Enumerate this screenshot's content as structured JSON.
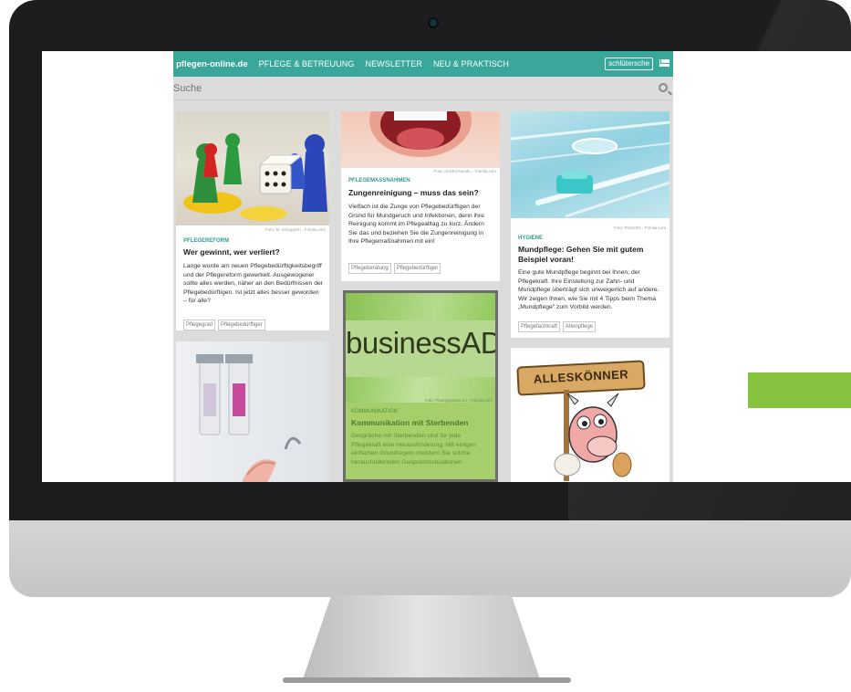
{
  "site": {
    "logo": "pflegen-online.de",
    "nav": [
      "PFLEGE & BETREUUNG",
      "NEWSLETTER",
      "NEU & PRAKTISCH"
    ],
    "publisher": "schlütersche",
    "search_placeholder": "Suche"
  },
  "cards": {
    "c1": {
      "credit": "Foto: M. Schuppich - Fotolia.com",
      "category": "PFLEGEREFORM",
      "title": "Wer gewinnt, wer verliert?",
      "text": "Lange wurde am neuen Pflegebedürftigkeitsbegriff und der Pflegereform gewerkelt. Ausgewogener sollte alles werden, näher an den Bedürfnissen der Pflegebedürftigen. Ist jetzt alles besser geworden – für alle?",
      "tags": [
        "Pflegegrad",
        "Pflegebedürftiger"
      ]
    },
    "c2": {
      "credit": "Foto: ALDECAstudio - Fotolia.com",
      "category": "PFLEGEMASSNAHMEN",
      "title": "Zungenreinigung – muss das sein?",
      "text": "Vielfach ist die Zunge von Pflegebedürftigen der Grund für Mundgeruch und Infektionen, denn ihre Reinigung kommt im Pflegealltag zu kurz. Ändern Sie das und beziehen Sie die Zungenreinigung in Ihre Pflegemaßnahmen mit ein!",
      "tags": [
        "Pflegeberatung",
        "Pflegebedürftiger"
      ]
    },
    "c3": {
      "credit": "Foto: PhotoSG - Fotolia.com",
      "category": "HYGIENE",
      "title": "Mundpflege: Gehen Sie mit gutem Beispiel voran!",
      "text": "Eine gute Mundpflege beginnt bei Ihnen, der Pflegekraft. Ihre Einstellung zur Zahn- und Mundpflege überträgt sich unweigerlich auf andere. Wir zeigen Ihnen, wie Sie mit 4 Tipps beim Thema „Mundpflege“ zum Vorbild werden.",
      "tags": [
        "Pflegefachkraft",
        "Altenpflege"
      ]
    },
    "ad": {
      "headline": "businessAD",
      "credit": "Foto: Photographee.eu - Fotolia.com",
      "category": "KOMMUNIKATION",
      "title": "Kommunikation mit Sterbenden",
      "text": "Gespräche mit Sterbenden sind für jede Pflegekraft eine Herausforderung. Mit einigen einfachen Grundregeln meistern Sie solche herausfordernden Gesprächssituationen."
    },
    "c6": {
      "sign": "ALLESKÖNNER"
    }
  },
  "colors": {
    "teal": "#3aa79b",
    "accent_green": "#86c33e",
    "ad_green": "#9fcd63"
  }
}
